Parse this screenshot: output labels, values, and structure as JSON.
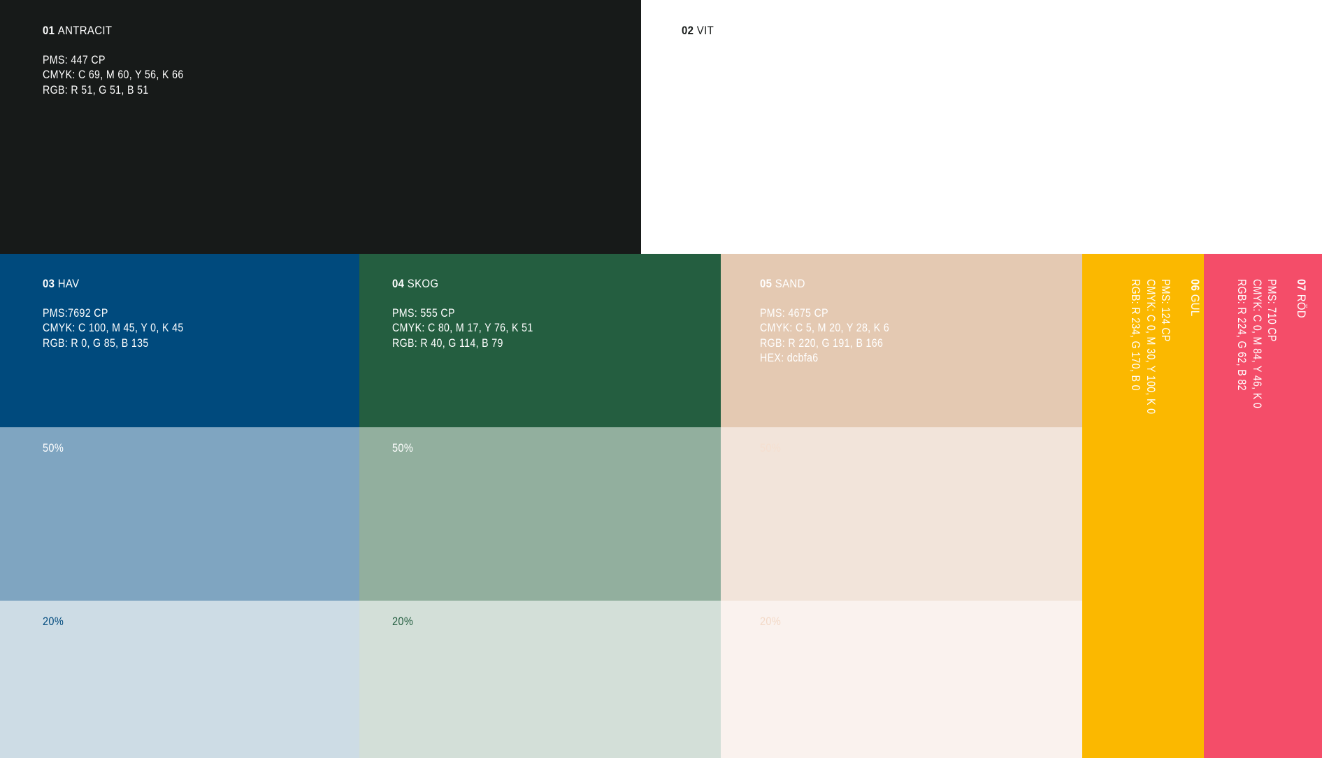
{
  "swatches": {
    "antracit": {
      "number": "01",
      "name": "ANTRACIT",
      "pms": "PMS: 447 CP",
      "cmyk": "CMYK: C 69, M 60, Y 56, K 66",
      "rgb": "RGB: R 51, G 51, B 51",
      "color": "#171a19"
    },
    "vit": {
      "number": "02",
      "name": "VIT",
      "color": "#ffffff"
    },
    "hav": {
      "number": "03",
      "name": "HAV",
      "pms": "PMS:7692 CP",
      "cmyk": "CMYK: C 100, M 45, Y 0, K 45",
      "rgb": "RGB: R 0, G 85, B 135",
      "color": "#004a7d",
      "tint50_label": "50%",
      "tint50_color": "#7fa5c1",
      "tint20_label": "20%",
      "tint20_color": "#cddce5"
    },
    "skog": {
      "number": "04",
      "name": "SKOG",
      "pms": "PMS: 555 CP",
      "cmyk": "CMYK: C 80, M 17, Y 76, K 51",
      "rgb": "RGB: R 40, G 114, B 79",
      "color": "#245e40",
      "tint50_label": "50%",
      "tint50_color": "#92af9e",
      "tint20_label": "20%",
      "tint20_color": "#d3dfd8"
    },
    "sand": {
      "number": "05",
      "name": "SAND",
      "pms": "PMS: 4675 CP",
      "cmyk": "CMYK: C 5, M 20, Y 28, K 6",
      "rgb": "RGB: R 220, G 191, B 166",
      "hex": "HEX: dcbfa6",
      "color": "#e4c9b2",
      "tint50_label": "50%",
      "tint50_color": "#f2e4da",
      "tint20_label": "20%",
      "tint20_color": "#faf2ee"
    },
    "gul": {
      "number": "06",
      "name": "GUL",
      "pms": "PMS: 124 CP",
      "cmyk": "CMYK: C 0, M 30, Y 100, K 0",
      "rgb": "RGB: R 234, G 170, B 0",
      "color": "#fbb800"
    },
    "rod": {
      "number": "07",
      "name": "RÖD",
      "pms": "PMS: 710 CP",
      "cmyk": "CMYK: C 0, M 84, Y 46, K 0",
      "rgb": "RGB: R 224, G 62, B 82",
      "color": "#f44d69"
    }
  }
}
